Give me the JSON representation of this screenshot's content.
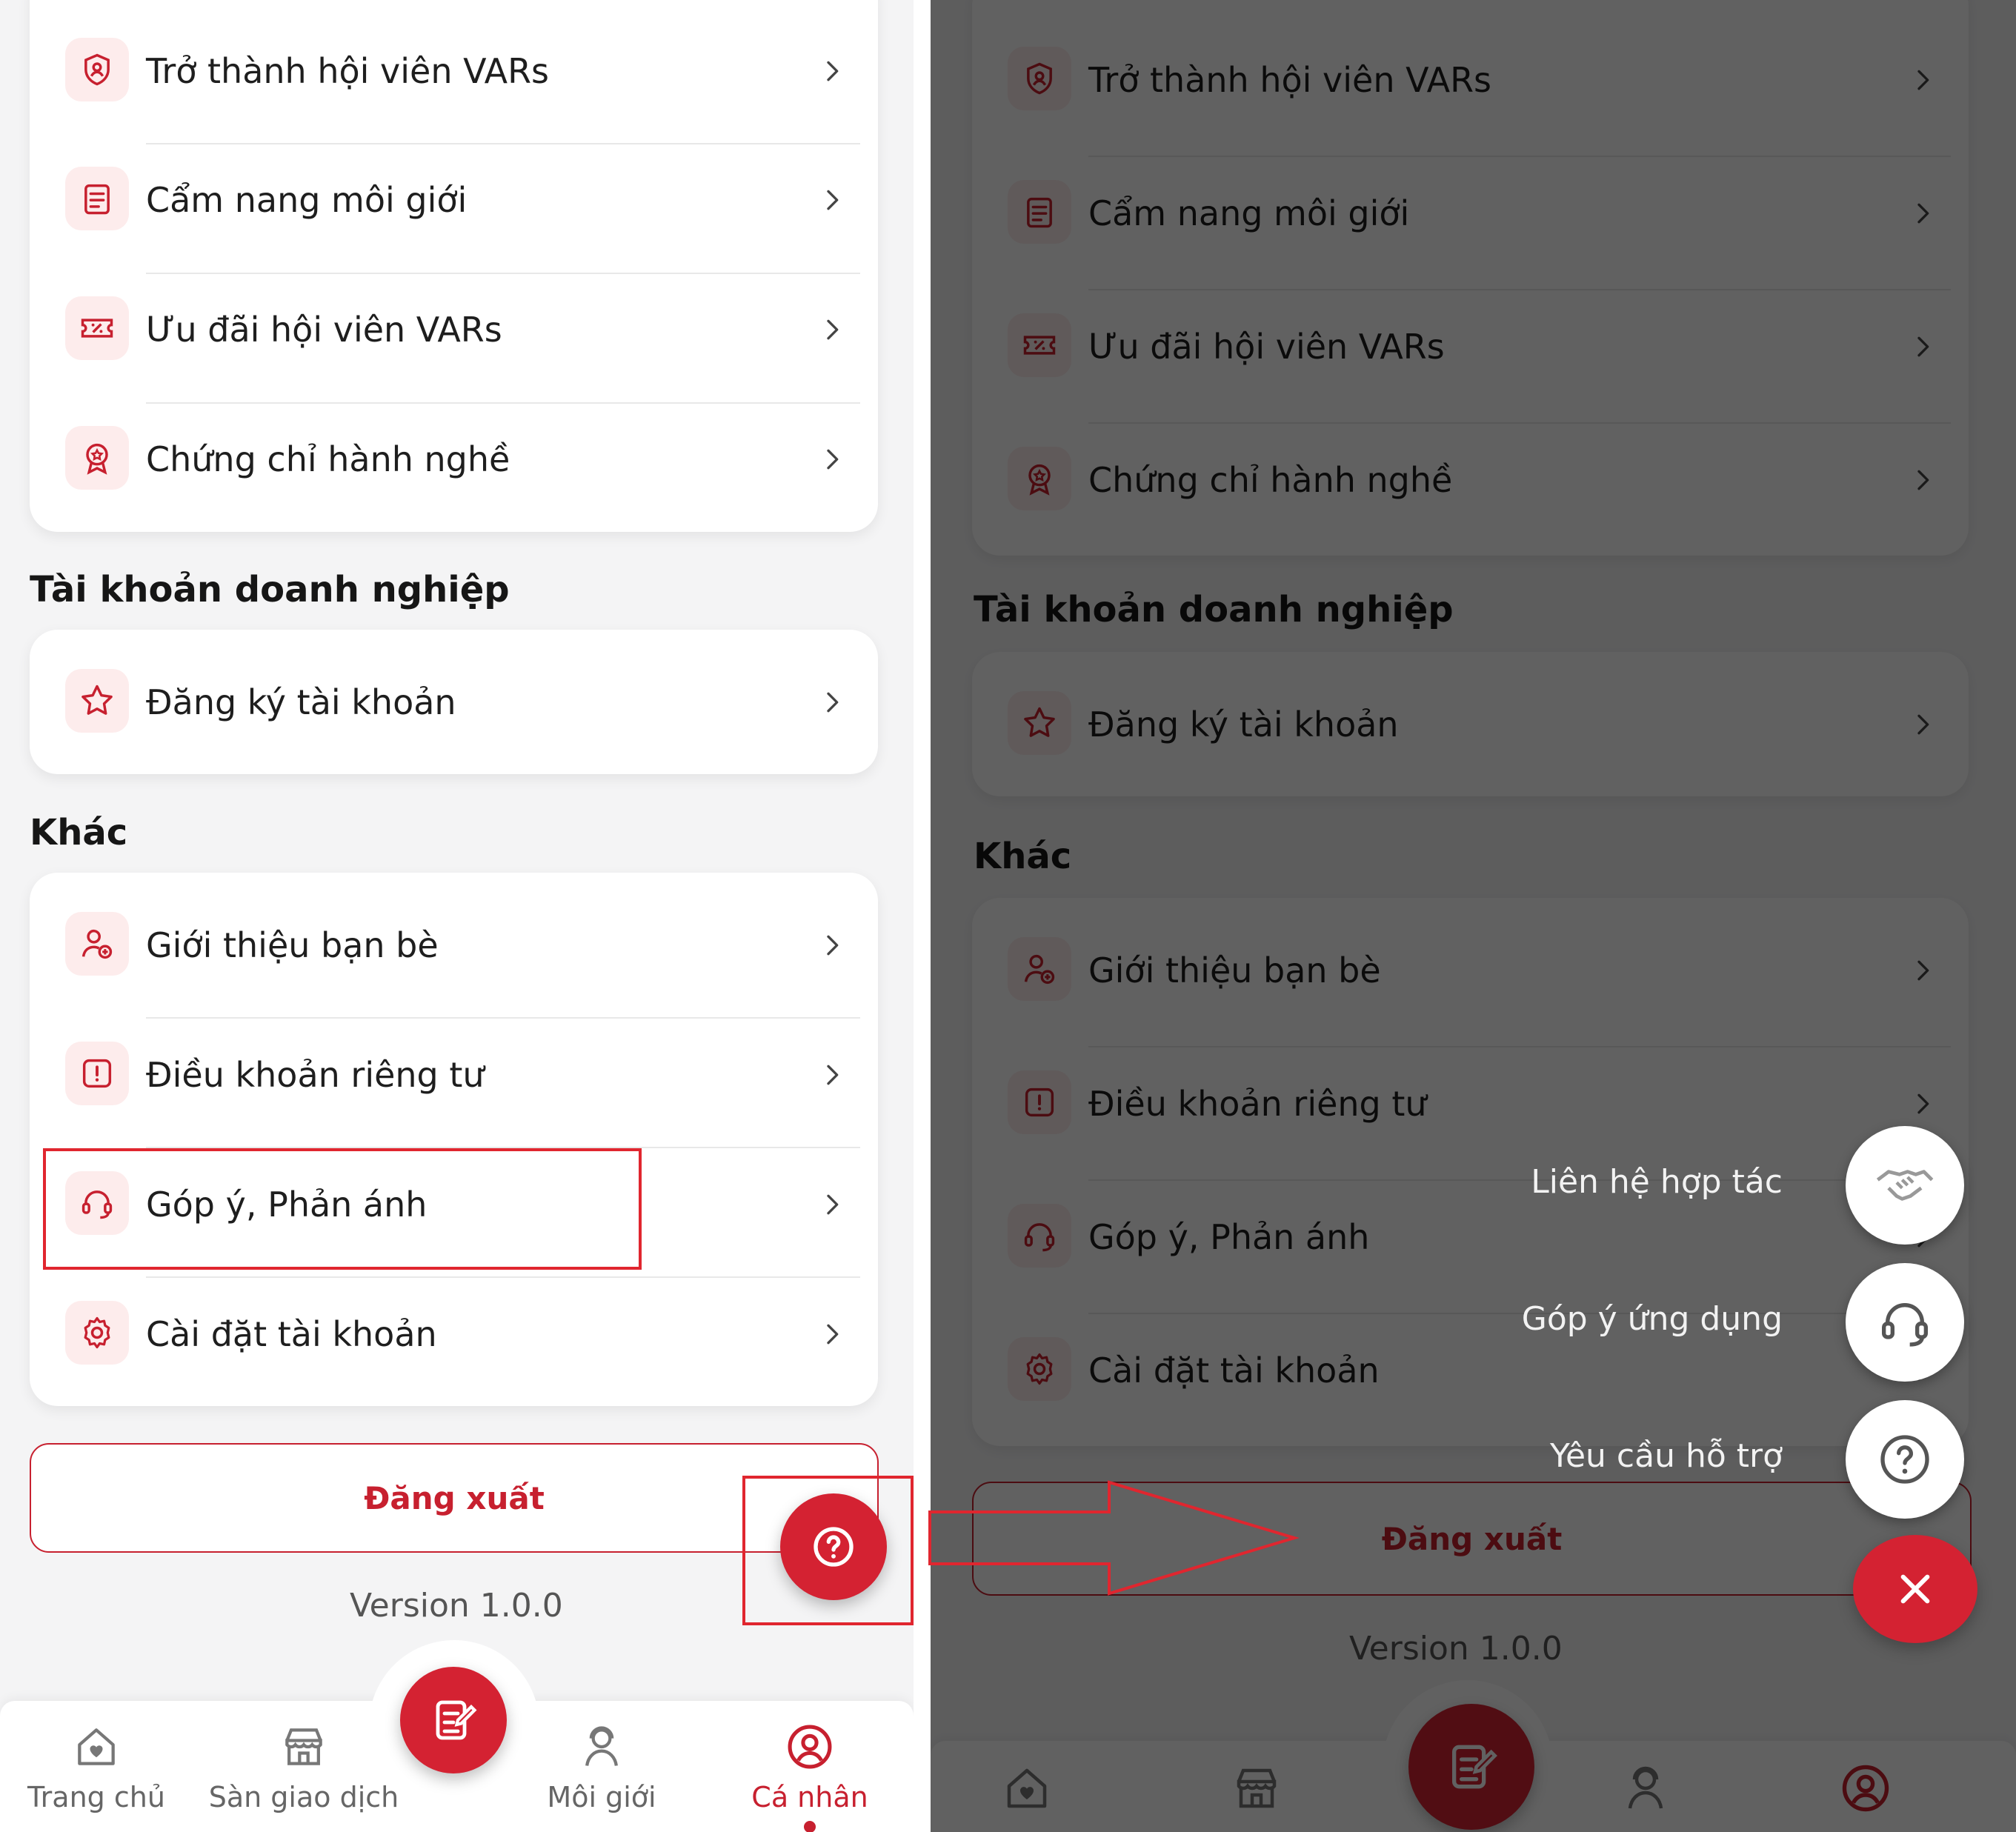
{
  "colors": {
    "brand": "#c7202f",
    "fab": "#d42232",
    "overlay": "#000000"
  },
  "menu": {
    "group1": [
      {
        "label": "Trở thành hội viên VARs",
        "icon": "shield-user-icon"
      },
      {
        "label": "Cẩm nang môi giới",
        "icon": "handbook-icon"
      },
      {
        "label": "Ưu đãi hội viên VARs",
        "icon": "discount-ticket-icon"
      },
      {
        "label": "Chứng chỉ hành nghề",
        "icon": "certificate-badge-icon"
      }
    ],
    "business_title": "Tài khoản doanh nghiệp",
    "group2": [
      {
        "label": "Đăng ký tài khoản",
        "icon": "star-icon"
      }
    ],
    "other_title": "Khác",
    "group3": [
      {
        "label": "Giới thiệu bạn bè",
        "icon": "add-friend-icon"
      },
      {
        "label": "Điều khoản riêng tư",
        "icon": "alert-icon"
      },
      {
        "label": "Góp ý, Phản ánh",
        "icon": "headset-icon"
      },
      {
        "label": "Cài đặt tài khoản",
        "icon": "gear-icon"
      }
    ],
    "logout_label": "Đăng xuất",
    "version": "Version 1.0.0"
  },
  "nav": [
    {
      "label": "Trang chủ",
      "icon": "home-heart-icon"
    },
    {
      "label": "Sàn giao dịch",
      "icon": "market-store-icon"
    },
    {
      "label": "",
      "icon": "edit-note-icon"
    },
    {
      "label": "Môi giới",
      "icon": "broker-person-icon"
    },
    {
      "label": "Cá nhân",
      "icon": "profile-user-icon"
    }
  ],
  "speed_dial": [
    {
      "label": "Liên hệ hợp tác",
      "icon": "handshake-icon"
    },
    {
      "label": "Góp ý ứng dụng",
      "icon": "headset-icon"
    },
    {
      "label": "Yêu cầu hỗ trợ",
      "icon": "question-circle-icon"
    }
  ]
}
